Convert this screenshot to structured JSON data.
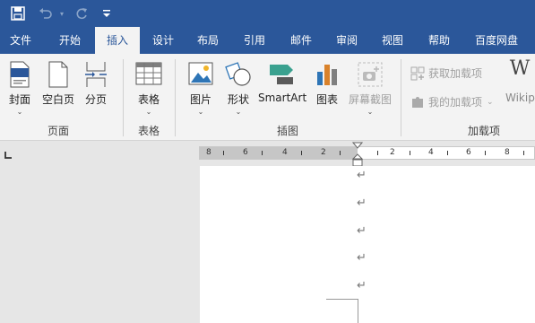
{
  "quick_access": {
    "save_icon": "save-icon",
    "undo_icon": "undo-icon",
    "redo_icon": "redo-icon",
    "customize_icon": "customize-qat-icon"
  },
  "tabs": [
    {
      "label": "文件"
    },
    {
      "label": "开始"
    },
    {
      "label": "插入"
    },
    {
      "label": "设计"
    },
    {
      "label": "布局"
    },
    {
      "label": "引用"
    },
    {
      "label": "邮件"
    },
    {
      "label": "审阅"
    },
    {
      "label": "视图"
    },
    {
      "label": "帮助"
    },
    {
      "label": "百度网盘"
    }
  ],
  "active_tab": "插入",
  "ribbon": {
    "pages": {
      "cover": "封面",
      "blank": "空白页",
      "break": "分页",
      "group": "页面"
    },
    "tables": {
      "table": "表格",
      "group": "表格"
    },
    "illustrations": {
      "picture": "图片",
      "shapes": "形状",
      "smartart": "SmartArt",
      "chart": "图表",
      "screenshot": "屏幕截图",
      "group": "插图"
    },
    "addins": {
      "get": "获取加载项",
      "mine": "我的加载项",
      "wiki": "Wikip",
      "group": "加载项"
    }
  },
  "ruler": {
    "left_numbers": [
      "8",
      "6",
      "4",
      "2"
    ],
    "right_numbers": [
      "2",
      "4",
      "6",
      "8"
    ]
  },
  "paragraph_mark": "↵",
  "colors": {
    "brand": "#2b579a",
    "ribbon_bg": "#f3f3f3",
    "workspace": "#e6e6e6"
  }
}
